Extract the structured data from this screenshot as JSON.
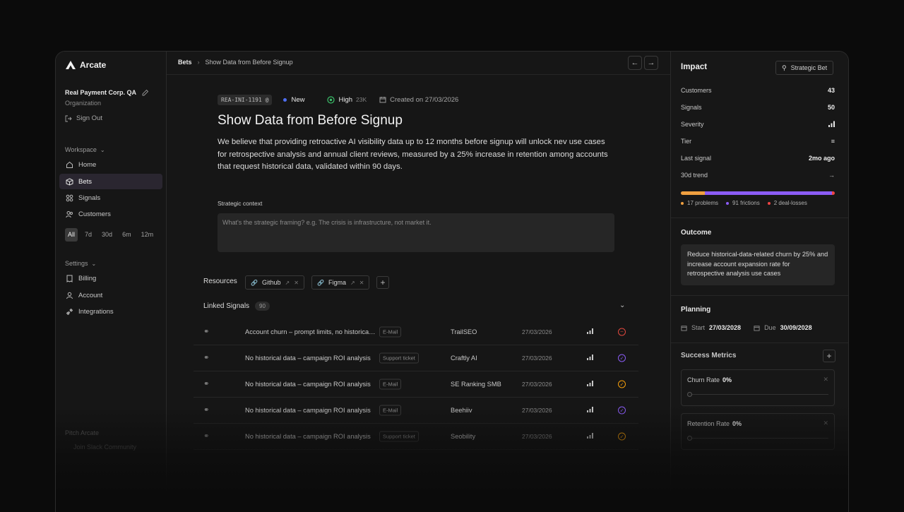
{
  "brand": {
    "name": "Arcate"
  },
  "org": {
    "name": "Real Payment Corp. QA",
    "type": "Organization",
    "signout": "Sign Out"
  },
  "workspace": {
    "label": "Workspace",
    "items": [
      {
        "label": "Home",
        "icon": "home-icon"
      },
      {
        "label": "Bets",
        "icon": "cube-icon"
      },
      {
        "label": "Signals",
        "icon": "signals-icon"
      },
      {
        "label": "Customers",
        "icon": "users-icon"
      }
    ],
    "ranges": [
      "All",
      "7d",
      "30d",
      "6m",
      "12m"
    ],
    "selected_range": "All"
  },
  "settings": {
    "label": "Settings",
    "items": [
      {
        "label": "Billing",
        "icon": "billing-icon"
      },
      {
        "label": "Account",
        "icon": "account-icon"
      },
      {
        "label": "Integrations",
        "icon": "integrations-icon"
      }
    ]
  },
  "sidebar_footer": {
    "line1": "Pitch Arcate",
    "line2": "Join Slack Community"
  },
  "breadcrumb": {
    "root": "Bets",
    "current": "Show Data from Before Signup"
  },
  "bet": {
    "id": "REA-INI-1191",
    "status": "New",
    "priority": "High",
    "priority_value": "23K",
    "created": "Created on 27/03/2026",
    "title": "Show Data from Before Signup",
    "description": "We believe that providing retroactive AI visibility data up to 12 months before signup will unlock nev use cases for retrospective analysis and annual client reviews, measured by a 25% increase in retention among accounts that request historical data, validated within 90 days."
  },
  "strategic_context": {
    "label": "Strategic context",
    "placeholder": "What's the strategic framing? e.g. The crisis is infrastructure, not market it."
  },
  "resources": {
    "label": "Resources",
    "items": [
      "Github",
      "Figma"
    ]
  },
  "linked_signals": {
    "label": "Linked Signals",
    "count": "90",
    "rows": [
      {
        "title": "Account churn – prompt limits, no historical data",
        "source": "E-Mail",
        "customer": "TrailSEO",
        "date": "27/03/2026",
        "status_color": "#e0483e",
        "status_icon": "minus"
      },
      {
        "title": "No historical data – campaign ROI analysis",
        "source": "Support ticket",
        "customer": "Craftly AI",
        "date": "27/03/2026",
        "status_color": "#8b5cf6",
        "status_icon": "check"
      },
      {
        "title": "No historical data – campaign ROI analysis",
        "source": "E-Mail",
        "customer": "SE Ranking SMB",
        "date": "27/03/2026",
        "status_color": "#f59e0b",
        "status_icon": "check"
      },
      {
        "title": "No historical data – campaign ROI analysis",
        "source": "E-Mail",
        "customer": "Beehiiv",
        "date": "27/03/2026",
        "status_color": "#8b5cf6",
        "status_icon": "check"
      },
      {
        "title": "No historical data – campaign ROI analysis",
        "source": "Support ticket",
        "customer": "Seobility",
        "date": "27/03/2026",
        "status_color": "#f59e0b",
        "status_icon": "check"
      }
    ]
  },
  "impact": {
    "title": "Impact",
    "strategic_bet": "Strategic Bet",
    "customers": {
      "label": "Customers",
      "value": "43"
    },
    "signals": {
      "label": "Signals",
      "value": "50"
    },
    "severity": {
      "label": "Severity"
    },
    "tier": {
      "label": "Tier"
    },
    "last_signal": {
      "label": "Last signal",
      "value": "2mo ago"
    },
    "trend": {
      "label": "30d trend"
    },
    "breakdown": [
      {
        "label": "17 problems",
        "value": 17,
        "color": "#f0a040"
      },
      {
        "label": "91 frictions",
        "value": 91,
        "color": "#8b5cf6"
      },
      {
        "label": "2 deal-losses",
        "value": 2,
        "color": "#ef4444"
      }
    ]
  },
  "outcome": {
    "title": "Outcome",
    "text": "Reduce historical-data-related churn by 25% and increase account expansion rate for retrospective analysis use cases"
  },
  "planning": {
    "title": "Planning",
    "start_label": "Start",
    "start": "27/03/2028",
    "due_label": "Due",
    "due": "30/09/2028"
  },
  "success_metrics": {
    "title": "Success Metrics",
    "items": [
      {
        "name": "Churn Rate",
        "value": "0%"
      },
      {
        "name": "Retention Rate",
        "value": "0%"
      }
    ]
  }
}
